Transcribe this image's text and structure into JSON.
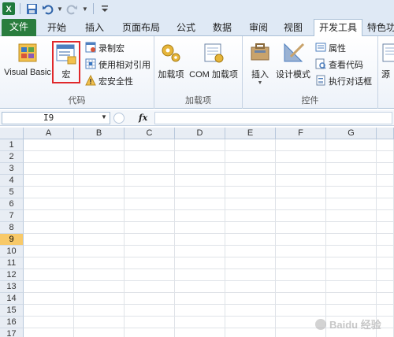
{
  "quick_access": {
    "excel_icon": "excel-logo-icon",
    "save_icon": "save-icon",
    "undo_icon": "undo-icon",
    "redo_icon": "redo-icon",
    "customize_icon": "customize-qat-icon"
  },
  "tabs": [
    {
      "label": "文件"
    },
    {
      "label": "开始"
    },
    {
      "label": "插入"
    },
    {
      "label": "页面布局"
    },
    {
      "label": "公式"
    },
    {
      "label": "数据"
    },
    {
      "label": "审阅"
    },
    {
      "label": "视图"
    },
    {
      "label": "开发工具"
    },
    {
      "label": "特色功"
    }
  ],
  "ribbon": {
    "code_group": {
      "label": "代码",
      "visual_basic": "Visual Basic",
      "macros": "宏",
      "record_macro": "录制宏",
      "relative_refs": "使用相对引用",
      "macro_security": "宏安全性"
    },
    "addins_group": {
      "label": "加载项",
      "addins": "加载项",
      "com_addins": "COM 加载项"
    },
    "controls_group": {
      "label": "控件",
      "insert": "插入",
      "design_mode": "设计模式",
      "properties": "属性",
      "view_code": "查看代码",
      "run_dialog": "执行对话框"
    },
    "source_partial": "源"
  },
  "formula_bar": {
    "name_box": "I9",
    "fx_label": "fx",
    "formula": ""
  },
  "grid": {
    "columns": [
      "A",
      "B",
      "C",
      "D",
      "E",
      "F",
      "G"
    ],
    "rows": [
      "1",
      "2",
      "3",
      "4",
      "5",
      "6",
      "7",
      "8",
      "9",
      "10",
      "11",
      "12",
      "13",
      "14",
      "15",
      "16",
      "17"
    ],
    "selected_row": "9"
  },
  "watermark": {
    "text": "Baidu 经验"
  },
  "colors": {
    "file_tab": "#2a7d3e",
    "highlight_box": "#e0282b",
    "selected_row": "#f8c968"
  }
}
